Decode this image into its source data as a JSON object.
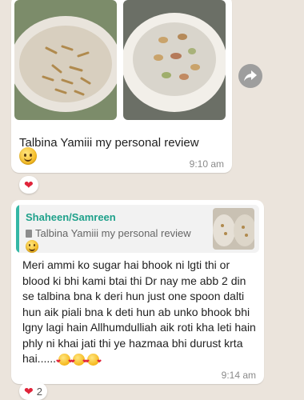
{
  "message1": {
    "caption": "Talbina Yamiii my personal review",
    "time": "9:10 am",
    "reaction_icon": "red-heart-icon"
  },
  "forward_icon": "forward-share-icon",
  "message2": {
    "quoted": {
      "author": "Shaheen/Samreen",
      "text": "Talbina Yamiii my personal review",
      "doc_icon": "document-icon"
    },
    "body": "Meri ammi ko sugar hai bhook ni lgti thi or blood ki bhi kami btai thi Dr nay me abb 2 din se talbina bna k deri hun just one spoon dalti hun aik piali bna k deti hun ab unko bhook bhi lgny lagi hain Allhumdulliah aik roti kha leti hain phly ni khai jati thi ye hazmaa bhi durust krta hai......",
    "time": "9:14 am",
    "reaction_count": "2"
  },
  "colors": {
    "chat_background": "#ebe4dc",
    "bubble": "#ffffff",
    "quote_accent": "#34b7a5",
    "author": "#1fa18b",
    "heart": "#e0243a",
    "timestamp": "#8a8a8a"
  }
}
